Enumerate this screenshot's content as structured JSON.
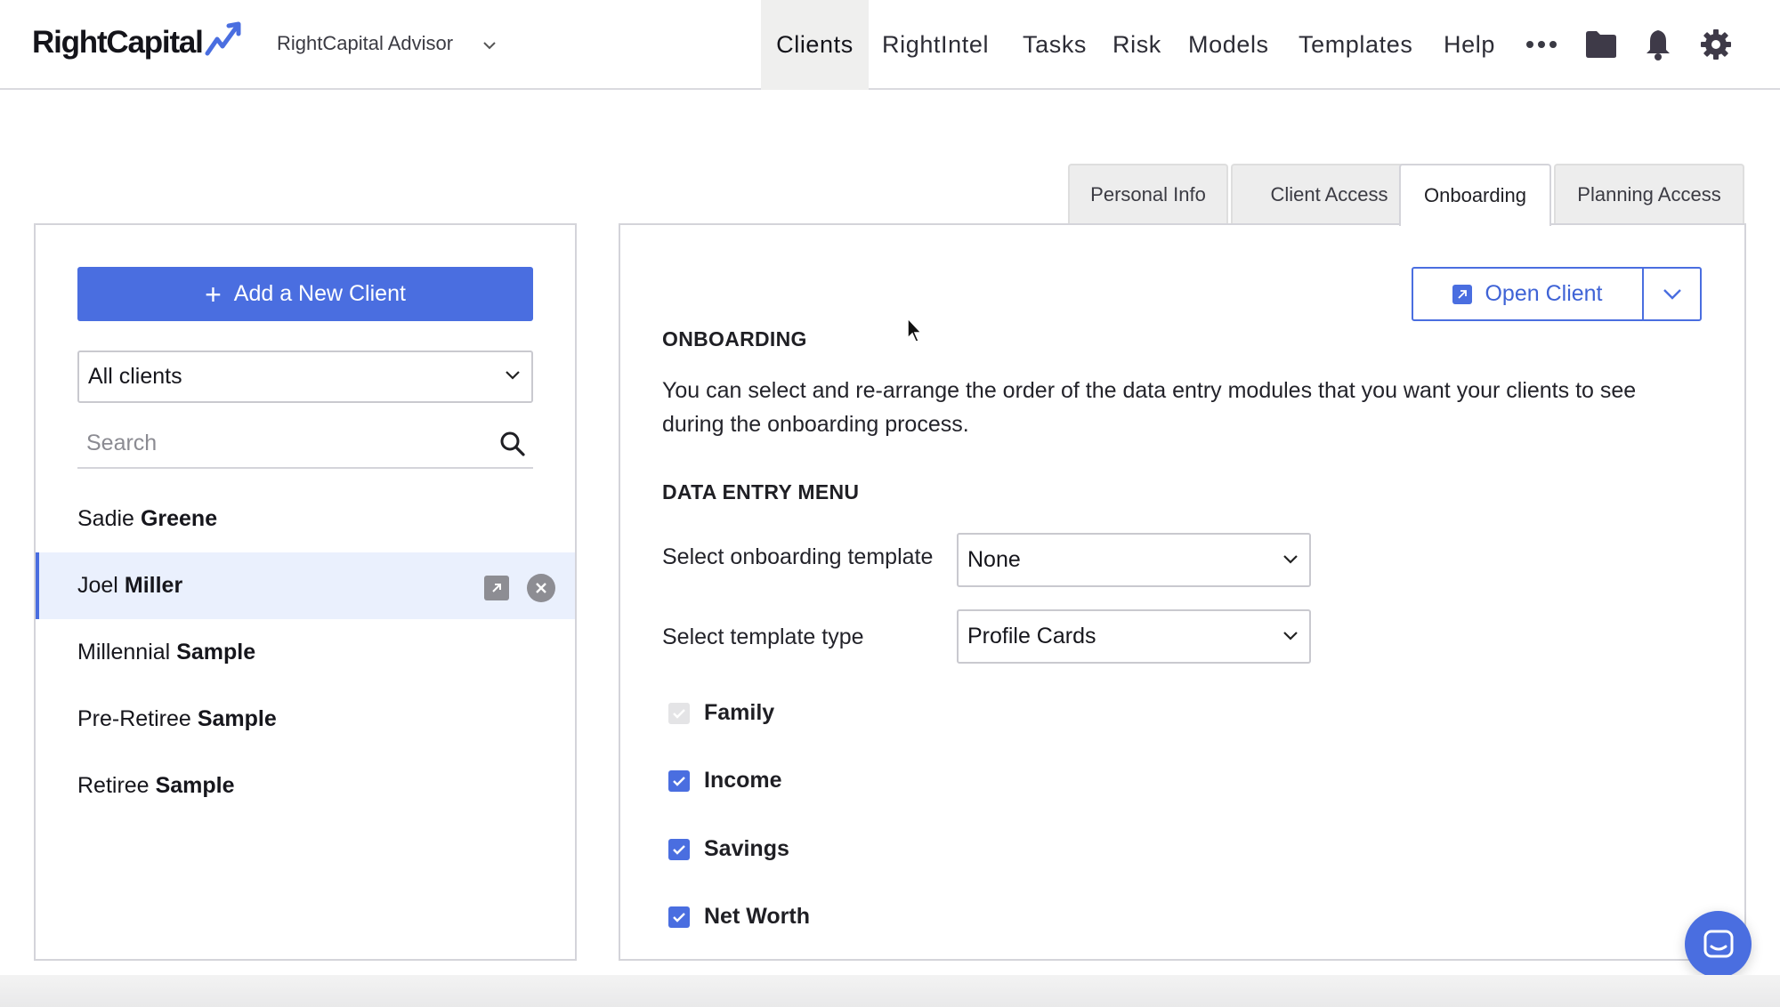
{
  "app": {
    "brand": "RightCapital",
    "advisor_label": "RightCapital Advisor",
    "accent_color": "#4a6ee0"
  },
  "nav": {
    "items": [
      "Clients",
      "RightIntel",
      "Tasks",
      "Risk",
      "Models",
      "Templates",
      "Help"
    ],
    "active": "Clients",
    "icons": [
      "more-icon",
      "folder-icon",
      "bell-icon",
      "gear-icon"
    ]
  },
  "left": {
    "add_button": "Add a New Client",
    "filter_value": "All clients",
    "search_placeholder": "Search",
    "clients": [
      {
        "first": "Sadie",
        "last": "Greene",
        "selected": false
      },
      {
        "first": "Joel",
        "last": "Miller",
        "selected": true
      },
      {
        "first": "Millennial",
        "last": "Sample",
        "selected": false
      },
      {
        "first": "Pre-Retiree",
        "last": "Sample",
        "selected": false
      },
      {
        "first": "Retiree",
        "last": "Sample",
        "selected": false
      }
    ]
  },
  "tabs": [
    "Personal Info",
    "Client Access",
    "Onboarding",
    "Planning Access"
  ],
  "active_tab": "Onboarding",
  "main": {
    "open_client": "Open Client",
    "section_title": "ONBOARDING",
    "description": "You can select and re-arrange the order of the data entry modules that you want your clients to see during the onboarding process.",
    "menu_title": "DATA ENTRY MENU",
    "template_label": "Select onboarding template",
    "template_value": "None",
    "type_label": "Select template type",
    "type_value": "Profile Cards",
    "modules": [
      {
        "label": "Family",
        "checked": true,
        "disabled": true
      },
      {
        "label": "Income",
        "checked": true,
        "disabled": false
      },
      {
        "label": "Savings",
        "checked": true,
        "disabled": false
      },
      {
        "label": "Net Worth",
        "checked": true,
        "disabled": false
      }
    ]
  }
}
